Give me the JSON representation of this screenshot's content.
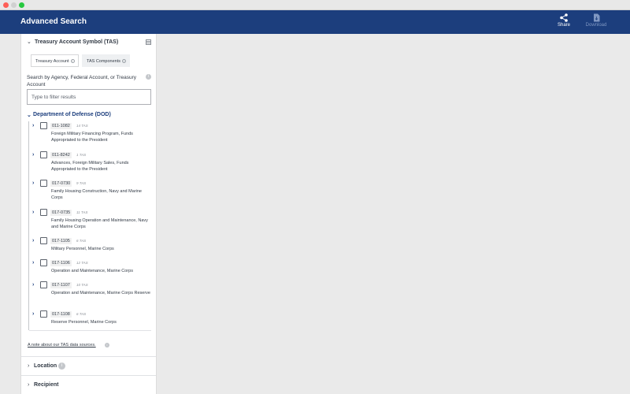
{
  "header": {
    "title": "Advanced Search",
    "share_label": "Share",
    "download_label": "Download"
  },
  "filter": {
    "section_title": "Treasury Account Symbol (TAS)",
    "tabs": [
      {
        "label": "Treasury Account"
      },
      {
        "label": "TAS Components"
      }
    ],
    "search_label": "Search by Agency, Federal Account, or Treasury Account",
    "search_placeholder": "Type to filter results",
    "agency": "Department of Defense (DOD)",
    "items": [
      {
        "code": "011-1082",
        "count": "14 TAS",
        "name": "Foreign Military Financing Program, Funds Appropriated to the President"
      },
      {
        "code": "011-8242",
        "count": "1 TAS",
        "name": "Advances, Foreign Military Sales, Funds Appropriated to the President"
      },
      {
        "code": "017-0730",
        "count": "9 TAS",
        "name": "Family Housing Construction, Navy and Marine Corps"
      },
      {
        "code": "017-0735",
        "count": "11 TAS",
        "name": "Family Housing Operation and Maintenance, Navy and Marine Corps"
      },
      {
        "code": "017-1105",
        "count": "6 TAS",
        "name": "Military Personnel, Marine Corps"
      },
      {
        "code": "017-1106",
        "count": "12 TAS",
        "name": "Operation and Maintenance, Marine Corps"
      },
      {
        "code": "017-1107",
        "count": "10 TAS",
        "name": "Operation and Maintenance, Marine Corps Reserve"
      },
      {
        "code": "017-1108",
        "count": "6 TAS",
        "name": "Reserve Personnel, Marine Corps"
      }
    ],
    "note_link": "A note about our TAS data sources."
  },
  "sections": [
    {
      "label": "Location"
    },
    {
      "label": "Recipient"
    }
  ],
  "colors": {
    "header_bg": "#1c3e7d",
    "accent": "#1c3e7d"
  },
  "icons": {
    "share": "share-icon",
    "download": "download-icon",
    "info": "info-icon"
  }
}
